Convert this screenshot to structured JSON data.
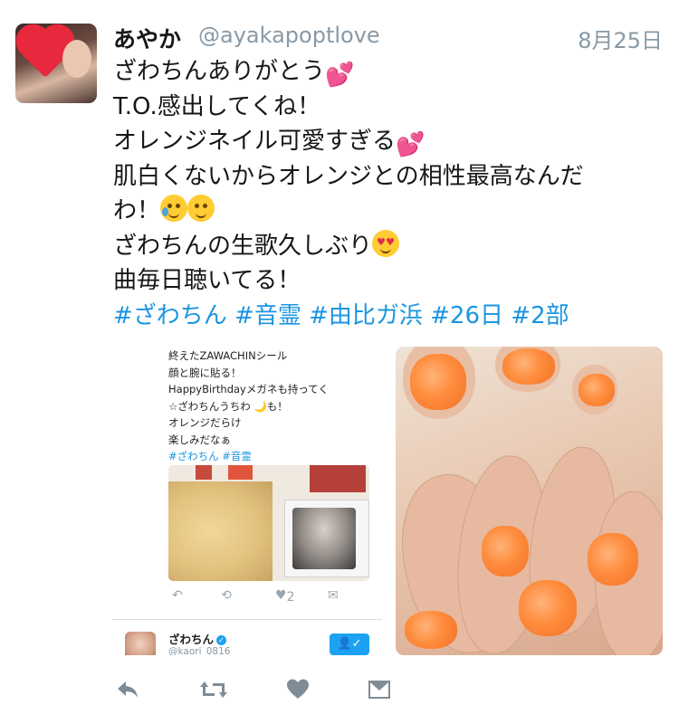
{
  "tweet": {
    "display_name": "あやか",
    "handle": "@ayakapoptlove",
    "date": "8月25日",
    "lines": [
      "ざわちんありがとう",
      "T.O.感出してくね！",
      "オレンジネイル可愛すぎる",
      "肌白くないからオレンジとの相性最高なんだ",
      "わ！",
      "ざわちんの生歌久しぶり",
      "曲毎日聴いてる！"
    ],
    "hashtags": "#ざわちん #音霊 #由比ガ浜 #26日 #2部",
    "emoji": [
      "two-hearts",
      "two-hearts",
      "crying-face",
      "smiling-face-blush",
      "heart-eyes-face"
    ]
  },
  "embedded_tweet": {
    "lines": [
      "終えたZAWACHINシール",
      "顔と腕に貼る！",
      "HappyBirthdayメガネも持ってく",
      "☆ざわちんうちわ 🌙も！",
      "オレンジだらけ",
      "楽しみだなぁ"
    ],
    "hashtags": "#ざわちん #音霊",
    "like_count": "2",
    "author_name": "ざわちん",
    "author_handle": "@kaori_0816"
  },
  "actions": [
    "reply-icon",
    "retweet-icon",
    "like-icon",
    "message-icon"
  ],
  "colors": {
    "link": "#1b95e0",
    "muted": "#8899a6",
    "action": "#aab8c2"
  }
}
